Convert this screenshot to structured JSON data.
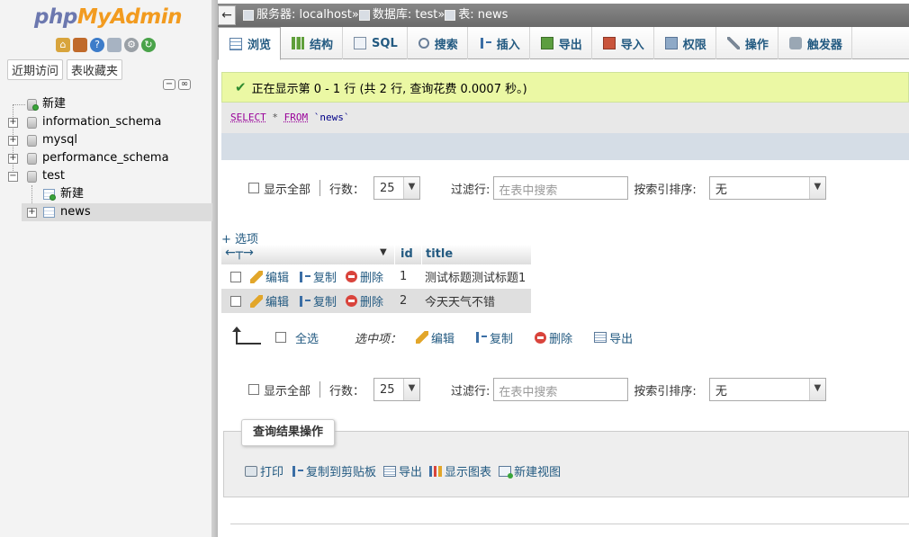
{
  "nav": {
    "logo_part1": "php",
    "logo_part2": "MyAdmin",
    "icons": [
      "home-icon",
      "database-icon",
      "help-icon",
      "docs-icon",
      "settings-icon",
      "reload-icon"
    ],
    "tabs": [
      "近期访问",
      "表收藏夹"
    ],
    "tree": [
      {
        "label": "新建",
        "type": "new"
      },
      {
        "label": "information_schema",
        "type": "db"
      },
      {
        "label": "mysql",
        "type": "db"
      },
      {
        "label": "performance_schema",
        "type": "db"
      },
      {
        "label": "test",
        "type": "db",
        "expanded": true
      },
      {
        "label": "新建",
        "type": "new-table"
      },
      {
        "label": "news",
        "type": "table",
        "selected": true
      }
    ]
  },
  "breadcrumb": {
    "back": "←",
    "server_label": "服务器: localhost",
    "db_label": "数据库: test",
    "table_label": "表: news",
    "separator": "»"
  },
  "tabs": [
    {
      "label": "浏览",
      "icon": "browse-icon",
      "active": true
    },
    {
      "label": "结构",
      "icon": "structure-icon"
    },
    {
      "label": "SQL",
      "icon": "sql-icon"
    },
    {
      "label": "搜索",
      "icon": "search-icon"
    },
    {
      "label": "插入",
      "icon": "insert-icon"
    },
    {
      "label": "导出",
      "icon": "export-icon"
    },
    {
      "label": "导入",
      "icon": "import-icon"
    },
    {
      "label": "权限",
      "icon": "privileges-icon"
    },
    {
      "label": "操作",
      "icon": "operations-icon"
    },
    {
      "label": "触发器",
      "icon": "triggers-icon"
    }
  ],
  "message": "正在显示第 0 - 1 行 (共 2 行, 查询花费 0.0007 秒。)",
  "sql": {
    "select": "SELECT",
    "star": "*",
    "from": "FROM",
    "table": "`news`"
  },
  "controls": {
    "show_all": "显示全部",
    "rows_label": "行数：",
    "rows_value": "25",
    "filter_label": "过滤行:",
    "filter_placeholder": "在表中搜索",
    "sort_label": "按索引排序:",
    "sort_value": "无"
  },
  "options_link": "+ 选项",
  "table": {
    "headers": [
      "id",
      "title"
    ],
    "rows": [
      {
        "id": "1",
        "title": "测试标题测试标题1"
      },
      {
        "id": "2",
        "title": "今天天气不错"
      }
    ],
    "actions": {
      "edit": "编辑",
      "copy": "复制",
      "delete": "删除"
    }
  },
  "bulk": {
    "check_all": "全选",
    "with_selected": "选中项：",
    "edit": "编辑",
    "copy": "复制",
    "delete": "删除",
    "export": "导出"
  },
  "query_ops": {
    "legend": "查询结果操作",
    "print": "打印",
    "copy_clipboard": "复制到剪贴板",
    "export": "导出",
    "show_chart": "显示图表",
    "create_view": "新建视图"
  }
}
